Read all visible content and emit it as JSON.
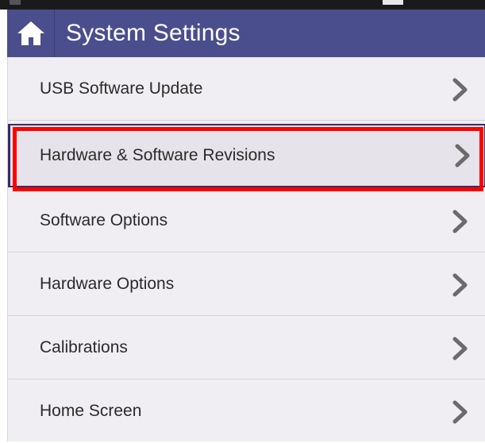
{
  "header": {
    "title": "System Settings",
    "home_icon": "home-icon",
    "accent_color": "#4a4e8c"
  },
  "menu": {
    "items": [
      {
        "label": "USB Software Update",
        "icon": "chevron-right-icon"
      },
      {
        "label": "Hardware & Software Revisions",
        "icon": "chevron-right-icon",
        "selected": true
      },
      {
        "label": "Software Options",
        "icon": "chevron-right-icon"
      },
      {
        "label": "Hardware Options",
        "icon": "chevron-right-icon"
      },
      {
        "label": "Calibrations",
        "icon": "chevron-right-icon"
      },
      {
        "label": "Home Screen",
        "icon": "chevron-right-icon"
      }
    ]
  },
  "annotation": {
    "highlight_color": "#ff0000"
  }
}
